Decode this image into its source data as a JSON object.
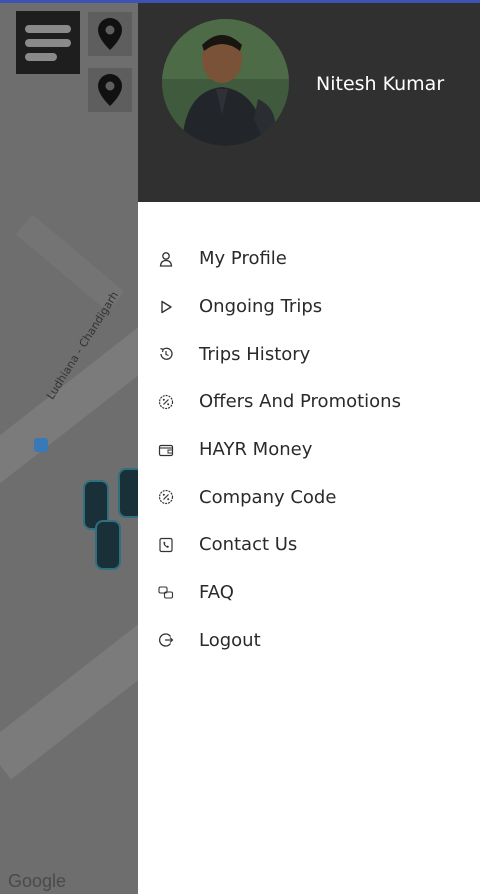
{
  "app": {
    "accent_color": "#3f51b5",
    "drawer_header_color": "#303030"
  },
  "map": {
    "road_label": "Ludhiana - Chandigarh",
    "attribution": "Google"
  },
  "controls": {
    "menu_icon": "hamburger-icon",
    "location_icons": [
      "map-pin-icon",
      "map-pin-icon"
    ]
  },
  "drawer": {
    "user": {
      "name": "Nitesh Kumar",
      "avatar": "profile-photo"
    },
    "items": [
      {
        "label": "My Profile",
        "icon": "person-icon"
      },
      {
        "label": "Ongoing Trips",
        "icon": "play-icon"
      },
      {
        "label": "Trips History",
        "icon": "history-icon"
      },
      {
        "label": "Offers And Promotions",
        "icon": "percent-badge-icon"
      },
      {
        "label": "HAYR Money",
        "icon": "wallet-icon"
      },
      {
        "label": "Company Code",
        "icon": "percent-badge-icon"
      },
      {
        "label": "Contact Us",
        "icon": "phone-icon"
      },
      {
        "label": "FAQ",
        "icon": "chat-bubbles-icon"
      },
      {
        "label": "Logout",
        "icon": "logout-icon"
      }
    ]
  }
}
